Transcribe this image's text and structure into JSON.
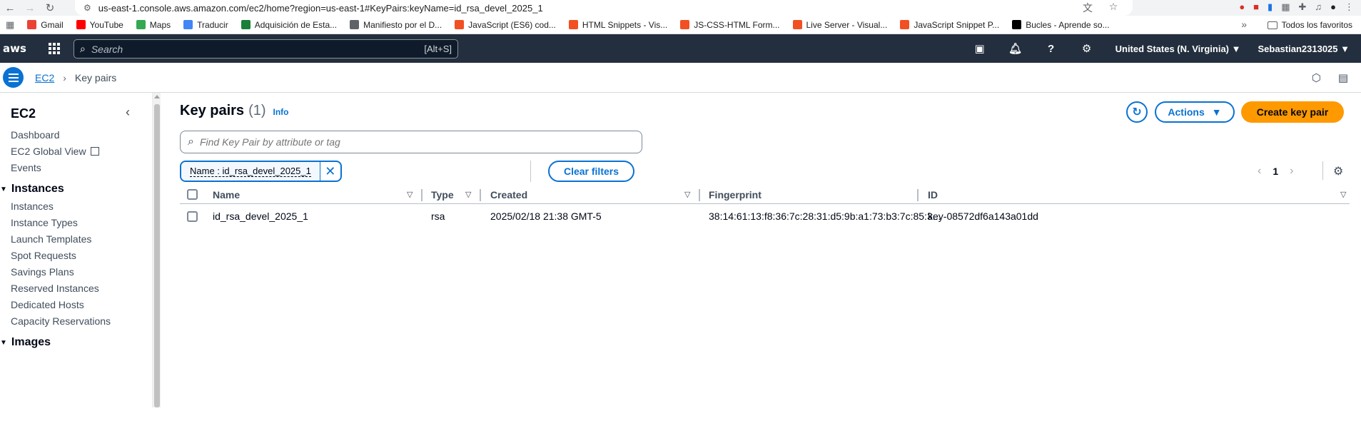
{
  "browser": {
    "url": "us-east-1.console.aws.amazon.com/ec2/home?region=us-east-1#KeyPairs:keyName=id_rsa_devel_2025_1",
    "bookmarks": [
      {
        "label": "Gmail",
        "color": "#ea4335"
      },
      {
        "label": "YouTube",
        "color": "#ff0000"
      },
      {
        "label": "Maps",
        "color": "#34a853"
      },
      {
        "label": "Traducir",
        "color": "#4285f4"
      },
      {
        "label": "Adquisición de Esta...",
        "color": "#188038"
      },
      {
        "label": "Manifiesto por el D...",
        "color": "#5f6368"
      },
      {
        "label": "JavaScript (ES6) cod...",
        "color": "#f25022"
      },
      {
        "label": "HTML Snippets - Vis...",
        "color": "#f25022"
      },
      {
        "label": "JS-CSS-HTML Form...",
        "color": "#f25022"
      },
      {
        "label": "Live Server - Visual...",
        "color": "#f25022"
      },
      {
        "label": "JavaScript Snippet P...",
        "color": "#f25022"
      },
      {
        "label": "Bucles - Aprende so...",
        "color": "#000000"
      }
    ],
    "all_bookmarks": "Todos los favoritos"
  },
  "aws_nav": {
    "logo": "aws",
    "search_placeholder": "Search",
    "search_shortcut": "[Alt+S]",
    "region": "United States (N. Virginia) ▼",
    "account": "Sebastian2313025 ▼"
  },
  "breadcrumb": {
    "service": "EC2",
    "current": "Key pairs"
  },
  "sidebar": {
    "title": "EC2",
    "top_items": [
      "Dashboard",
      "EC2 Global View",
      "Events"
    ],
    "instances_section": "Instances",
    "instances_items": [
      "Instances",
      "Instance Types",
      "Launch Templates",
      "Spot Requests",
      "Savings Plans",
      "Reserved Instances",
      "Dedicated Hosts",
      "Capacity Reservations"
    ],
    "images_section": "Images"
  },
  "main": {
    "title": "Key pairs",
    "count": "(1)",
    "info": "Info",
    "actions_label": "Actions",
    "create_label": "Create key pair",
    "search_placeholder": "Find Key Pair by attribute or tag",
    "filter_token": "Name : id_rsa_devel_2025_1",
    "clear_filters": "Clear filters",
    "page": "1"
  },
  "table": {
    "columns": [
      "Name",
      "Type",
      "Created",
      "Fingerprint",
      "ID"
    ],
    "rows": [
      {
        "name": "id_rsa_devel_2025_1",
        "type": "rsa",
        "created": "2025/02/18 21:38 GMT-5",
        "fingerprint": "38:14:61:13:f8:36:7c:28:31:d5:9b:a1:73:b3:7c:85:3...",
        "id": "key-08572df6a143a01dd"
      }
    ]
  },
  "colors": {
    "accent": "#0972d3",
    "primary_button": "#ff9900",
    "nav_bg": "#232f3e"
  }
}
